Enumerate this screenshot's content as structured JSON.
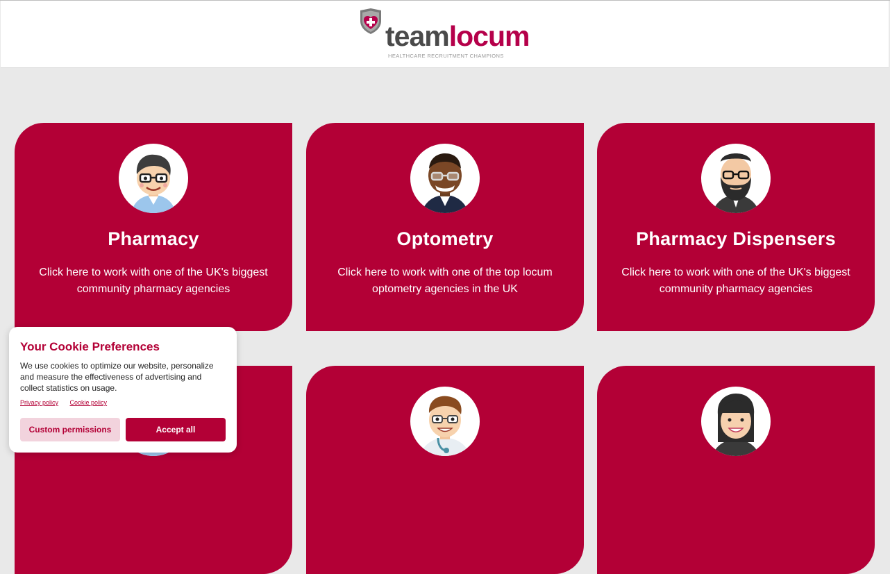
{
  "brand": {
    "name_part1": "team",
    "name_part2": "locum",
    "tagline": "HEALTHCARE RECRUITMENT CHAMPIONS",
    "colors": {
      "primary": "#b30036",
      "dark_text": "#4a4a4a",
      "background": "#e9e9e9"
    }
  },
  "cards": [
    {
      "title": "Pharmacy",
      "description": "Click here to work with one of the UK's biggest community pharmacy agencies",
      "icon": "pharmacist-avatar-icon"
    },
    {
      "title": "Optometry",
      "description": "Click here to work with one of the top locum optometry agencies in the UK",
      "icon": "optometrist-avatar-icon"
    },
    {
      "title": "Pharmacy Dispensers",
      "description": "Click here to work with one of the UK's biggest community pharmacy agencies",
      "icon": "dispenser-avatar-icon"
    },
    {
      "title": "",
      "description": "",
      "icon": "avatar-icon"
    },
    {
      "title": "",
      "description": "",
      "icon": "doctor-avatar-icon"
    },
    {
      "title": "",
      "description": "",
      "icon": "woman-avatar-icon"
    }
  ],
  "cookie_banner": {
    "title": "Your Cookie Preferences",
    "text": "We use cookies to optimize our website, personalize and measure the effectiveness of advertising and collect statistics on usage.",
    "privacy_link": "Privacy policy",
    "cookie_link": "Cookie policy",
    "custom_button": "Custom permissions",
    "accept_button": "Accept all"
  }
}
